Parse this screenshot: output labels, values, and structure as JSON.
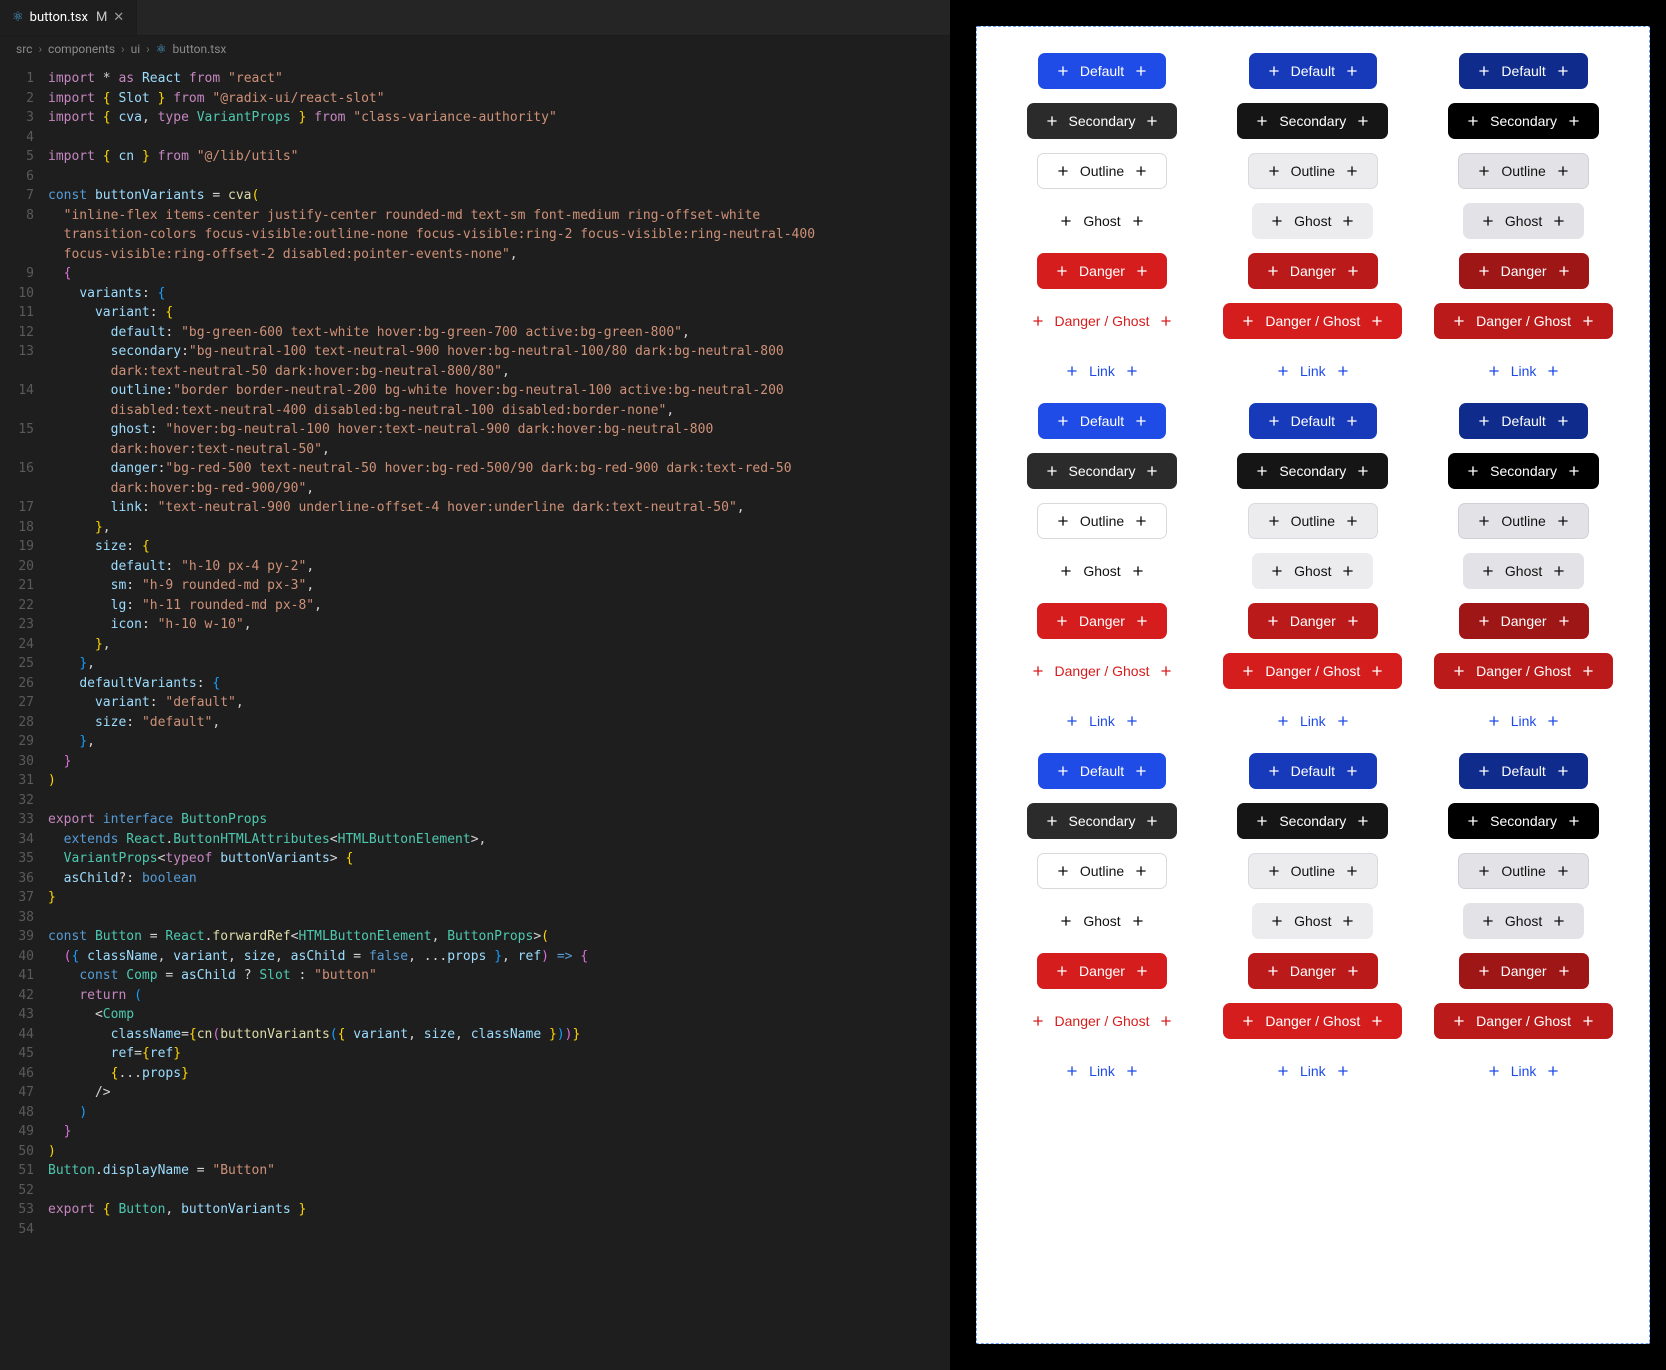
{
  "editor": {
    "tab": {
      "filename": "button.tsx",
      "mod_marker": "M",
      "close_glyph": "✕"
    },
    "breadcrumbs": [
      "src",
      "components",
      "ui",
      "button.tsx"
    ],
    "react_icon": "⚛",
    "lines": [
      {
        "n": 1,
        "h": "<span class='kw'>import</span> <span class='op'>*</span> <span class='kw'>as</span> <span class='var'>React</span> <span class='kw'>from</span> <span class='str'>\"react\"</span>"
      },
      {
        "n": 2,
        "h": "<span class='kw'>import</span> <span class='br'>{</span> <span class='var'>Slot</span> <span class='br'>}</span> <span class='kw'>from</span> <span class='str'>\"@radix-ui/react-slot\"</span>"
      },
      {
        "n": 3,
        "h": "<span class='kw'>import</span> <span class='br'>{</span> <span class='var'>cva</span><span class='punc'>,</span> <span class='kw'>type</span> <span class='id'>VariantProps</span> <span class='br'>}</span> <span class='kw'>from</span> <span class='str'>\"class-variance-authority\"</span>"
      },
      {
        "n": 4,
        "h": ""
      },
      {
        "n": 5,
        "h": "<span class='kw'>import</span> <span class='br'>{</span> <span class='var'>cn</span> <span class='br'>}</span> <span class='kw'>from</span> <span class='str'>\"@/lib/utils\"</span>"
      },
      {
        "n": 6,
        "h": ""
      },
      {
        "n": 7,
        "h": "<span class='kw2'>const</span> <span class='var'>buttonVariants</span> <span class='op'>=</span> <span class='fn'>cva</span><span class='br'>(</span>"
      },
      {
        "n": 8,
        "h": "  <span class='str'>\"inline-flex items-center justify-center rounded-md text-sm font-medium ring-offset-white </span>"
      },
      {
        "n": null,
        "h": "  <span class='str'>transition-colors focus-visible:outline-none focus-visible:ring-2 focus-visible:ring-neutral-400 </span>"
      },
      {
        "n": null,
        "h": "  <span class='str'>focus-visible:ring-offset-2 disabled:pointer-events-none\"</span><span class='punc'>,</span>"
      },
      {
        "n": 9,
        "h": "  <span class='brp'>{</span>"
      },
      {
        "n": 10,
        "h": "    <span class='var'>variants</span><span class='punc'>:</span> <span class='brb'>{</span>"
      },
      {
        "n": 11,
        "h": "      <span class='var'>variant</span><span class='punc'>:</span> <span class='br'>{</span>"
      },
      {
        "n": 12,
        "h": "        <span class='var'>default</span><span class='punc'>:</span> <span class='str'>\"bg-green-600 text-white hover:bg-green-700 active:bg-green-800\"</span><span class='punc'>,</span>"
      },
      {
        "n": 13,
        "h": "        <span class='var'>secondary</span><span class='punc'>:</span><span class='str'>\"bg-neutral-100 text-neutral-900 hover:bg-neutral-100/80 dark:bg-neutral-800 </span>"
      },
      {
        "n": null,
        "h": "        <span class='str'>dark:text-neutral-50 dark:hover:bg-neutral-800/80\"</span><span class='punc'>,</span>"
      },
      {
        "n": 14,
        "h": "        <span class='var'>outline</span><span class='punc'>:</span><span class='str'>\"border border-neutral-200 bg-white hover:bg-neutral-100 active:bg-neutral-200 </span>"
      },
      {
        "n": null,
        "h": "        <span class='str'>disabled:text-neutral-400 disabled:bg-neutral-100 disabled:border-none\"</span><span class='punc'>,</span>"
      },
      {
        "n": 15,
        "h": "        <span class='var'>ghost</span><span class='punc'>:</span> <span class='str'>\"hover:bg-neutral-100 hover:text-neutral-900 dark:hover:bg-neutral-800 </span>"
      },
      {
        "n": null,
        "h": "        <span class='str'>dark:hover:text-neutral-50\"</span><span class='punc'>,</span>"
      },
      {
        "n": 16,
        "h": "        <span class='var'>danger</span><span class='punc'>:</span><span class='str'>\"bg-red-500 text-neutral-50 hover:bg-red-500/90 dark:bg-red-900 dark:text-red-50 </span>"
      },
      {
        "n": null,
        "h": "        <span class='str'>dark:hover:bg-red-900/90\"</span><span class='punc'>,</span>"
      },
      {
        "n": 17,
        "h": "        <span class='var'>link</span><span class='punc'>:</span> <span class='str'>\"text-neutral-900 underline-offset-4 hover:underline dark:text-neutral-50\"</span><span class='punc'>,</span>"
      },
      {
        "n": 18,
        "h": "      <span class='br'>}</span><span class='punc'>,</span>"
      },
      {
        "n": 19,
        "h": "      <span class='var'>size</span><span class='punc'>:</span> <span class='br'>{</span>"
      },
      {
        "n": 20,
        "h": "        <span class='var'>default</span><span class='punc'>:</span> <span class='str'>\"h-10 px-4 py-2\"</span><span class='punc'>,</span>"
      },
      {
        "n": 21,
        "h": "        <span class='var'>sm</span><span class='punc'>:</span> <span class='str'>\"h-9 rounded-md px-3\"</span><span class='punc'>,</span>"
      },
      {
        "n": 22,
        "h": "        <span class='var'>lg</span><span class='punc'>:</span> <span class='str'>\"h-11 rounded-md px-8\"</span><span class='punc'>,</span>"
      },
      {
        "n": 23,
        "h": "        <span class='var'>icon</span><span class='punc'>:</span> <span class='str'>\"h-10 w-10\"</span><span class='punc'>,</span>"
      },
      {
        "n": 24,
        "h": "      <span class='br'>}</span><span class='punc'>,</span>"
      },
      {
        "n": 25,
        "h": "    <span class='brb'>}</span><span class='punc'>,</span>"
      },
      {
        "n": 26,
        "h": "    <span class='var'>defaultVariants</span><span class='punc'>:</span> <span class='brb'>{</span>"
      },
      {
        "n": 27,
        "h": "      <span class='var'>variant</span><span class='punc'>:</span> <span class='str'>\"default\"</span><span class='punc'>,</span>"
      },
      {
        "n": 28,
        "h": "      <span class='var'>size</span><span class='punc'>:</span> <span class='str'>\"default\"</span><span class='punc'>,</span>"
      },
      {
        "n": 29,
        "h": "    <span class='brb'>}</span><span class='punc'>,</span>"
      },
      {
        "n": 30,
        "h": "  <span class='brp'>}</span>"
      },
      {
        "n": 31,
        "h": "<span class='br'>)</span>"
      },
      {
        "n": 32,
        "h": ""
      },
      {
        "n": 33,
        "h": "<span class='kw'>export</span> <span class='kw2'>interface</span> <span class='id'>ButtonProps</span>"
      },
      {
        "n": 34,
        "h": "  <span class='kw2'>extends</span> <span class='id'>React</span><span class='punc'>.</span><span class='id'>ButtonHTMLAttributes</span><span class='punc'>&lt;</span><span class='id'>HTMLButtonElement</span><span class='punc'>&gt;,</span>"
      },
      {
        "n": 35,
        "h": "  <span class='id'>VariantProps</span><span class='punc'>&lt;</span><span class='kw'>typeof</span> <span class='var'>buttonVariants</span><span class='punc'>&gt;</span> <span class='br'>{</span>"
      },
      {
        "n": 36,
        "h": "  <span class='var'>asChild</span><span class='punc'>?:</span> <span class='kw2'>boolean</span>"
      },
      {
        "n": 37,
        "h": "<span class='br'>}</span>"
      },
      {
        "n": 38,
        "h": ""
      },
      {
        "n": 39,
        "h": "<span class='kw2'>const</span> <span class='id'>Button</span> <span class='op'>=</span> <span class='id'>React</span><span class='punc'>.</span><span class='fn'>forwardRef</span><span class='punc'>&lt;</span><span class='id'>HTMLButtonElement</span><span class='punc'>,</span> <span class='id'>ButtonProps</span><span class='punc'>&gt;</span><span class='br'>(</span>"
      },
      {
        "n": 40,
        "h": "  <span class='brp'>(</span><span class='brb'>{</span> <span class='var'>className</span><span class='punc'>,</span> <span class='var'>variant</span><span class='punc'>,</span> <span class='var'>size</span><span class='punc'>,</span> <span class='var'>asChild</span> <span class='op'>=</span> <span class='kw2'>false</span><span class='punc'>,</span> <span class='punc'>...</span><span class='var'>props</span> <span class='brb'>}</span><span class='punc'>,</span> <span class='var'>ref</span><span class='brp'>)</span> <span class='kw2'>=&gt;</span> <span class='brp'>{</span>"
      },
      {
        "n": 41,
        "h": "    <span class='kw2'>const</span> <span class='id'>Comp</span> <span class='op'>=</span> <span class='var'>asChild</span> <span class='op'>?</span> <span class='id'>Slot</span> <span class='op'>:</span> <span class='str'>\"button\"</span>"
      },
      {
        "n": 42,
        "h": "    <span class='kw'>return</span> <span class='brb'>(</span>"
      },
      {
        "n": 43,
        "h": "      <span class='punc'>&lt;</span><span class='id'>Comp</span>"
      },
      {
        "n": 44,
        "h": "        <span class='var'>className</span><span class='op'>=</span><span class='br'>{</span><span class='fn'>cn</span><span class='brp'>(</span><span class='fn'>buttonVariants</span><span class='brb'>(</span><span class='br'>{</span> <span class='var'>variant</span><span class='punc'>,</span> <span class='var'>size</span><span class='punc'>,</span> <span class='var'>className</span> <span class='br'>}</span><span class='brb'>)</span><span class='brp'>)</span><span class='br'>}</span>"
      },
      {
        "n": 45,
        "h": "        <span class='var'>ref</span><span class='op'>=</span><span class='br'>{</span><span class='var'>ref</span><span class='br'>}</span>"
      },
      {
        "n": 46,
        "h": "        <span class='br'>{</span><span class='punc'>...</span><span class='var'>props</span><span class='br'>}</span>"
      },
      {
        "n": 47,
        "h": "      <span class='punc'>/&gt;</span>"
      },
      {
        "n": 48,
        "h": "    <span class='brb'>)</span>"
      },
      {
        "n": 49,
        "h": "  <span class='brp'>}</span>"
      },
      {
        "n": 50,
        "h": "<span class='br'>)</span>"
      },
      {
        "n": 51,
        "h": "<span class='id'>Button</span><span class='punc'>.</span><span class='var'>displayName</span> <span class='op'>=</span> <span class='str'>\"Button\"</span>"
      },
      {
        "n": 52,
        "h": ""
      },
      {
        "n": 53,
        "h": "<span class='kw'>export</span> <span class='br'>{</span> <span class='id'>Button</span><span class='punc'>,</span> <span class='var'>buttonVariants</span> <span class='br'>}</span>"
      },
      {
        "n": 54,
        "h": ""
      }
    ]
  },
  "preview": {
    "blocks": 3,
    "columns": 3,
    "variants": [
      {
        "key": "default",
        "label": "Default"
      },
      {
        "key": "secondary",
        "label": "Secondary"
      },
      {
        "key": "outline",
        "label": "Outline"
      },
      {
        "key": "ghost",
        "label": "Ghost"
      },
      {
        "key": "danger",
        "label": "Danger"
      },
      {
        "key": "dangerghost",
        "label": "Danger / Ghost"
      },
      {
        "key": "link",
        "label": "Link"
      }
    ]
  }
}
